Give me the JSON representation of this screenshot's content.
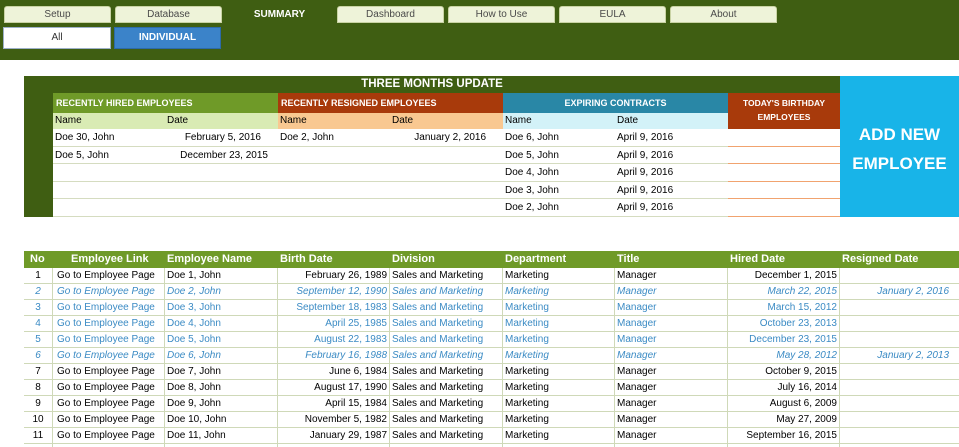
{
  "tabs": [
    "Setup",
    "Database",
    "SUMMARY",
    "Dashboard",
    "How to Use",
    "EULA",
    "About"
  ],
  "subtabs": {
    "all": "All",
    "individual": "INDIVIDUAL"
  },
  "panel": {
    "title": "THREE MONTHS UPDATE",
    "hired": {
      "header": "RECENTLY HIRED EMPLOYEES",
      "col_name": "Name",
      "col_date": "Date",
      "rows": [
        {
          "name": "Doe 30, John",
          "date": "February 5, 2016"
        },
        {
          "name": "Doe 5, John",
          "date": "December 23, 2015"
        }
      ]
    },
    "resigned": {
      "header": "RECENTLY RESIGNED EMPLOYEES",
      "col_name": "Name",
      "col_date": "Date",
      "rows": [
        {
          "name": "Doe 2, John",
          "date": "January 2, 2016"
        }
      ]
    },
    "expiring": {
      "header": "EXPIRING CONTRACTS",
      "col_name": "Name",
      "col_date": "Date",
      "rows": [
        {
          "name": "Doe 6, John",
          "date": "April 9, 2016"
        },
        {
          "name": "Doe 5, John",
          "date": "April 9, 2016"
        },
        {
          "name": "Doe 4, John",
          "date": "April 9, 2016"
        },
        {
          "name": "Doe 3, John",
          "date": "April 9, 2016"
        },
        {
          "name": "Doe 2, John",
          "date": "April 9, 2016"
        }
      ]
    },
    "birthday": {
      "header_line1": "TODAY'S BIRTHDAY",
      "header_line2": "EMPLOYEES"
    }
  },
  "add_new": {
    "line1": "ADD NEW",
    "line2": "EMPLOYEE"
  },
  "employees": {
    "headers": [
      "No",
      "Employee Link",
      "Employee Name",
      "Birth Date",
      "Division",
      "Department",
      "Title",
      "Hired Date",
      "Resigned Date"
    ],
    "rows": [
      {
        "no": "1",
        "link": "Go to Employee Page",
        "name": "Doe 1, John",
        "birth": "February 26, 1989",
        "division": "Sales and Marketing",
        "dept": "Marketing",
        "title": "Manager",
        "hired": "December 1, 2015",
        "resigned": "",
        "style": "normal"
      },
      {
        "no": "2",
        "link": "Go to Employee Page",
        "name": "Doe 2, John",
        "birth": "September 12, 1990",
        "division": "Sales and Marketing",
        "dept": "Marketing",
        "title": "Manager",
        "hired": "March 22, 2015",
        "resigned": "January 2, 2016",
        "style": "res"
      },
      {
        "no": "3",
        "link": "Go to Employee Page",
        "name": "Doe 3, John",
        "birth": "September 18, 1983",
        "division": "Sales and Marketing",
        "dept": "Marketing",
        "title": "Manager",
        "hired": "March 15, 2012",
        "resigned": "",
        "style": "blue"
      },
      {
        "no": "4",
        "link": "Go to Employee Page",
        "name": "Doe 4, John",
        "birth": "April 25, 1985",
        "division": "Sales and Marketing",
        "dept": "Marketing",
        "title": "Manager",
        "hired": "October 23, 2013",
        "resigned": "",
        "style": "blue"
      },
      {
        "no": "5",
        "link": "Go to Employee Page",
        "name": "Doe 5, John",
        "birth": "August 22, 1983",
        "division": "Sales and Marketing",
        "dept": "Marketing",
        "title": "Manager",
        "hired": "December 23, 2015",
        "resigned": "",
        "style": "blue"
      },
      {
        "no": "6",
        "link": "Go to Employee Page",
        "name": "Doe 6, John",
        "birth": "February 16, 1988",
        "division": "Sales and Marketing",
        "dept": "Marketing",
        "title": "Manager",
        "hired": "May 28, 2012",
        "resigned": "January 2, 2013",
        "style": "res"
      },
      {
        "no": "7",
        "link": "Go to Employee Page",
        "name": "Doe 7, John",
        "birth": "June 6, 1984",
        "division": "Sales and Marketing",
        "dept": "Marketing",
        "title": "Manager",
        "hired": "October 9, 2015",
        "resigned": "",
        "style": "normal"
      },
      {
        "no": "8",
        "link": "Go to Employee Page",
        "name": "Doe 8, John",
        "birth": "August 17, 1990",
        "division": "Sales and Marketing",
        "dept": "Marketing",
        "title": "Manager",
        "hired": "July 16, 2014",
        "resigned": "",
        "style": "normal"
      },
      {
        "no": "9",
        "link": "Go to Employee Page",
        "name": "Doe 9, John",
        "birth": "April 15, 1984",
        "division": "Sales and Marketing",
        "dept": "Marketing",
        "title": "Manager",
        "hired": "August 6, 2009",
        "resigned": "",
        "style": "normal"
      },
      {
        "no": "10",
        "link": "Go to Employee Page",
        "name": "Doe 10, John",
        "birth": "November 5, 1982",
        "division": "Sales and Marketing",
        "dept": "Marketing",
        "title": "Manager",
        "hired": "May 27, 2009",
        "resigned": "",
        "style": "normal"
      },
      {
        "no": "11",
        "link": "Go to Employee Page",
        "name": "Doe 11, John",
        "birth": "January 29, 1987",
        "division": "Sales and Marketing",
        "dept": "Marketing",
        "title": "Manager",
        "hired": "September 16, 2015",
        "resigned": "",
        "style": "normal"
      }
    ]
  }
}
